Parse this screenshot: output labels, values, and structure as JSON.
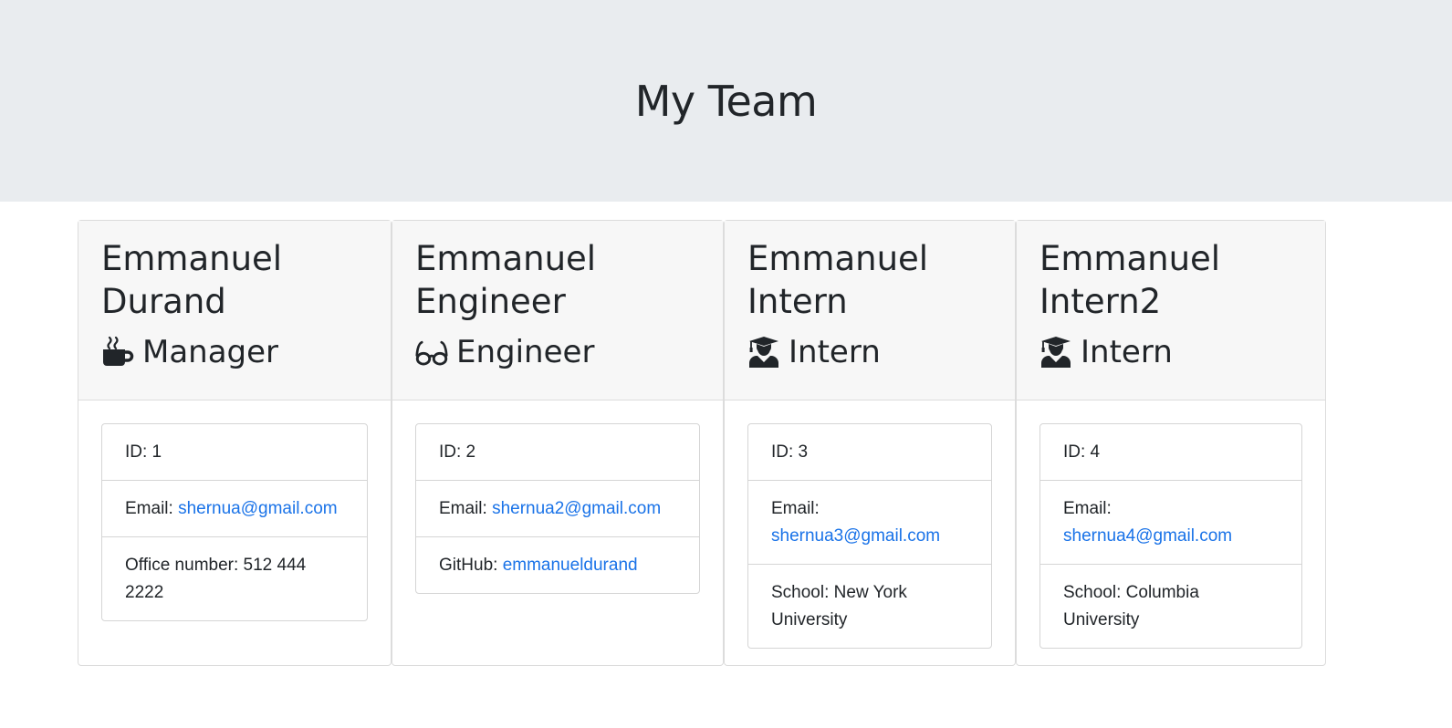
{
  "header": {
    "title": "My Team"
  },
  "employees": [
    {
      "name_line1": "Emmanuel",
      "name_line2": "Durand",
      "role": "Manager",
      "role_icon": "coffee-icon",
      "id_label": "ID: 1",
      "email_label": "Email:",
      "email": "shernua@gmail.com",
      "extra_label": "Office number: 512 444 2222",
      "extra_value": ""
    },
    {
      "name_line1": "Emmanuel",
      "name_line2": "Engineer",
      "role": "Engineer",
      "role_icon": "glasses-icon",
      "id_label": "ID: 2",
      "email_label": "Email:",
      "email": "shernua2@gmail.com",
      "extra_label": "GitHub:",
      "extra_value": "emmanueldurand"
    },
    {
      "name_line1": "Emmanuel",
      "name_line2": "Intern",
      "role": "Intern",
      "role_icon": "graduate-icon",
      "id_label": "ID: 3",
      "email_label": "Email:",
      "email": "shernua3@gmail.com",
      "extra_label": "School: New York University",
      "extra_value": ""
    },
    {
      "name_line1": "Emmanuel",
      "name_line2": "Intern2",
      "role": "Intern",
      "role_icon": "graduate-icon",
      "id_label": "ID: 4",
      "email_label": "Email:",
      "email": "shernua4@gmail.com",
      "extra_label": "School: Columbia University",
      "extra_value": ""
    }
  ],
  "colors": {
    "jumbotron_bg": "#e9ecef",
    "link": "#1a73e8",
    "card_header_bg": "#f7f7f7"
  }
}
